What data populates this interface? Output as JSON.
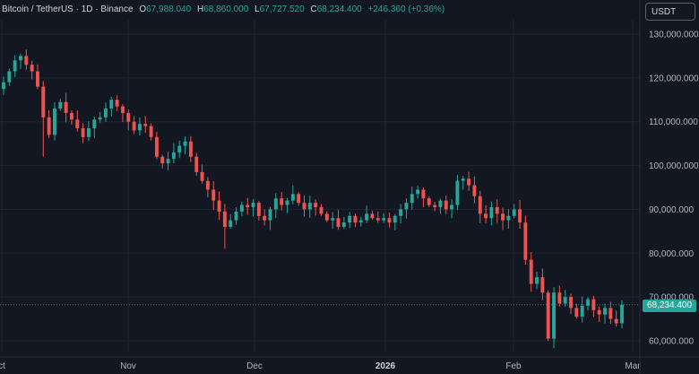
{
  "legend": {
    "symbol": "Bitcoin / TetherUS · 1D · Binance",
    "open_label": "O",
    "open": "67,988.040",
    "high_label": "H",
    "high": "68,860.000",
    "low_label": "L",
    "low": "67,727.520",
    "close_label": "C",
    "close": "68,234.400",
    "change": "+246.360 (+0.36%)"
  },
  "currency": "USDT",
  "last_price": "68,234.400",
  "colors": {
    "up": "#26a69a",
    "down": "#ef5350",
    "background": "#131722",
    "grid": "#1f2430"
  },
  "chart_data": {
    "type": "candlestick",
    "y_ticks": [
      "130,000.000",
      "120,000.000",
      "110,000.000",
      "100,000.000",
      "90,000.000",
      "80,000.000",
      "70,000.000",
      "60,000.000"
    ],
    "x_ticks": [
      {
        "label": "ct",
        "bold": false
      },
      {
        "label": "Nov",
        "bold": false
      },
      {
        "label": "Dec",
        "bold": false
      },
      {
        "label": "2026",
        "bold": true
      },
      {
        "label": "Feb",
        "bold": false
      },
      {
        "label": "Mar",
        "bold": false
      }
    ],
    "ylim": [
      57000,
      134000
    ],
    "grid": true,
    "last_price": 68234.4,
    "series_close": [
      119000,
      121500,
      124000,
      125000,
      123000,
      121500,
      118000,
      111000,
      107000,
      113000,
      114500,
      112000,
      110500,
      108500,
      106500,
      108500,
      110500,
      111000,
      113000,
      115000,
      113500,
      112000,
      110000,
      108000,
      109500,
      109000,
      106500,
      102000,
      100500,
      101500,
      103000,
      104500,
      105500,
      102000,
      98500,
      96500,
      94500,
      92000,
      89500,
      86000,
      87500,
      89500,
      91000,
      90500,
      91500,
      88500,
      87500,
      90000,
      92500,
      91000,
      92000,
      93500,
      91500,
      90000,
      91500,
      90500,
      89000,
      87500,
      88000,
      86000,
      87000,
      88500,
      87000,
      87500,
      89000,
      88000,
      87500,
      88000,
      87000,
      88500,
      90000,
      91500,
      93500,
      94500,
      92500,
      91000,
      90500,
      92000,
      90000,
      91000,
      96500,
      97000,
      95500,
      93000,
      89000,
      88000,
      90500,
      89000,
      87500,
      88500,
      90000,
      87000,
      78500,
      73000,
      74500,
      71000,
      60500,
      71000,
      68500,
      70000,
      67500,
      65500,
      68000,
      69500,
      67000,
      66000,
      67500,
      65000,
      64000,
      68234
    ]
  }
}
